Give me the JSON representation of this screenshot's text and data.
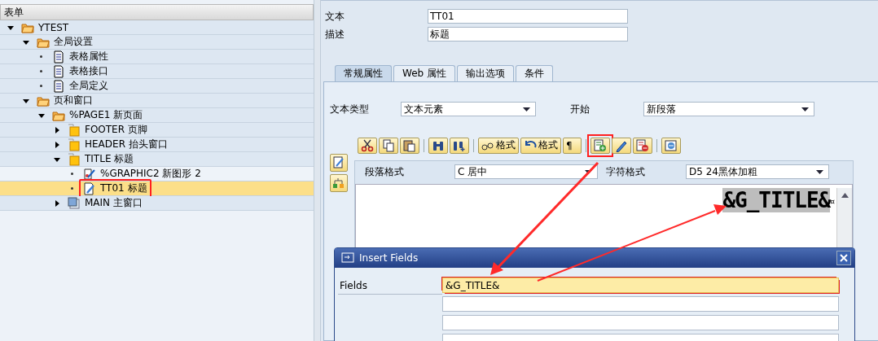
{
  "tree": {
    "title": "表单",
    "items": [
      {
        "kind": "folder",
        "label": "YTEST",
        "expanded": true,
        "selected": false,
        "highlighted": false,
        "children": [
          {
            "kind": "folder",
            "label": "全局设置",
            "expanded": true,
            "selected": false,
            "highlighted": false,
            "children": [
              {
                "kind": "doc",
                "label": "表格属性",
                "selected": false,
                "highlighted": false
              },
              {
                "kind": "doc",
                "label": "表格接口",
                "selected": false,
                "highlighted": false
              },
              {
                "kind": "doc",
                "label": "全局定义",
                "selected": false,
                "highlighted": false
              }
            ]
          },
          {
            "kind": "folder",
            "label": "页和窗口",
            "expanded": true,
            "selected": false,
            "highlighted": false,
            "children": [
              {
                "kind": "folder",
                "label": "%PAGE1 新页面",
                "expanded": true,
                "selected": false,
                "highlighted": false,
                "children": [
                  {
                    "kind": "window",
                    "label": "FOOTER 页脚",
                    "expanded": false,
                    "selected": false,
                    "highlighted": false
                  },
                  {
                    "kind": "window",
                    "label": "HEADER 抬头窗口",
                    "expanded": false,
                    "selected": false,
                    "highlighted": false
                  },
                  {
                    "kind": "window",
                    "label": "TITLE 标题",
                    "expanded": true,
                    "selected": false,
                    "highlighted": false,
                    "children": [
                      {
                        "kind": "graphic",
                        "label": "%GRAPHIC2 新图形 2",
                        "selected": false,
                        "highlighted": false
                      },
                      {
                        "kind": "text",
                        "label": "TT01 标题",
                        "selected": true,
                        "highlighted": true
                      }
                    ]
                  },
                  {
                    "kind": "main",
                    "label": "MAIN 主窗口",
                    "expanded": false,
                    "selected": false,
                    "highlighted": false
                  }
                ]
              }
            ]
          }
        ]
      }
    ]
  },
  "fields": [
    {
      "label": "文本",
      "value": "TT01"
    },
    {
      "label": "描述",
      "value": "标题"
    }
  ],
  "tabs": [
    {
      "label": "常规属性",
      "selected": true
    },
    {
      "label": "Web 属性",
      "selected": false
    },
    {
      "label": "输出选项",
      "selected": false
    },
    {
      "label": "条件",
      "selected": false
    }
  ],
  "settings": [
    {
      "label": "文本类型",
      "value": "文本元素"
    },
    {
      "label": "开始",
      "value": "新段落"
    }
  ],
  "toolbar": [
    {
      "kind": "button",
      "highlighted": false
    },
    {
      "kind": "button",
      "highlighted": false
    },
    {
      "kind": "button",
      "highlighted": false
    },
    {
      "kind": "separator"
    },
    {
      "kind": "button",
      "highlighted": false
    },
    {
      "kind": "button",
      "highlighted": false
    },
    {
      "kind": "separator"
    },
    {
      "kind": "button",
      "label": "格式",
      "highlighted": false
    },
    {
      "kind": "button",
      "label": "格式",
      "highlighted": false
    },
    {
      "kind": "button",
      "label": "¶",
      "highlighted": false
    },
    {
      "kind": "separator"
    },
    {
      "kind": "button",
      "highlighted": true
    },
    {
      "kind": "button",
      "highlighted": false
    },
    {
      "kind": "button",
      "highlighted": false
    },
    {
      "kind": "separator"
    },
    {
      "kind": "button",
      "highlighted": false
    }
  ],
  "formats": [
    {
      "label": "段落格式",
      "value": "C 居中"
    },
    {
      "label": "字符格式",
      "value": "D5 24黑体加粗"
    }
  ],
  "editor": {
    "text": "&G_TITLE&",
    "selected": true,
    "end_mark": "¤"
  },
  "dialog": {
    "title": "Insert Fields",
    "label": "Fields",
    "rows": [
      {
        "value": "&G_TITLE&",
        "focused": true
      },
      {
        "focused": false
      },
      {
        "focused": false
      },
      {
        "focused": false
      }
    ]
  }
}
